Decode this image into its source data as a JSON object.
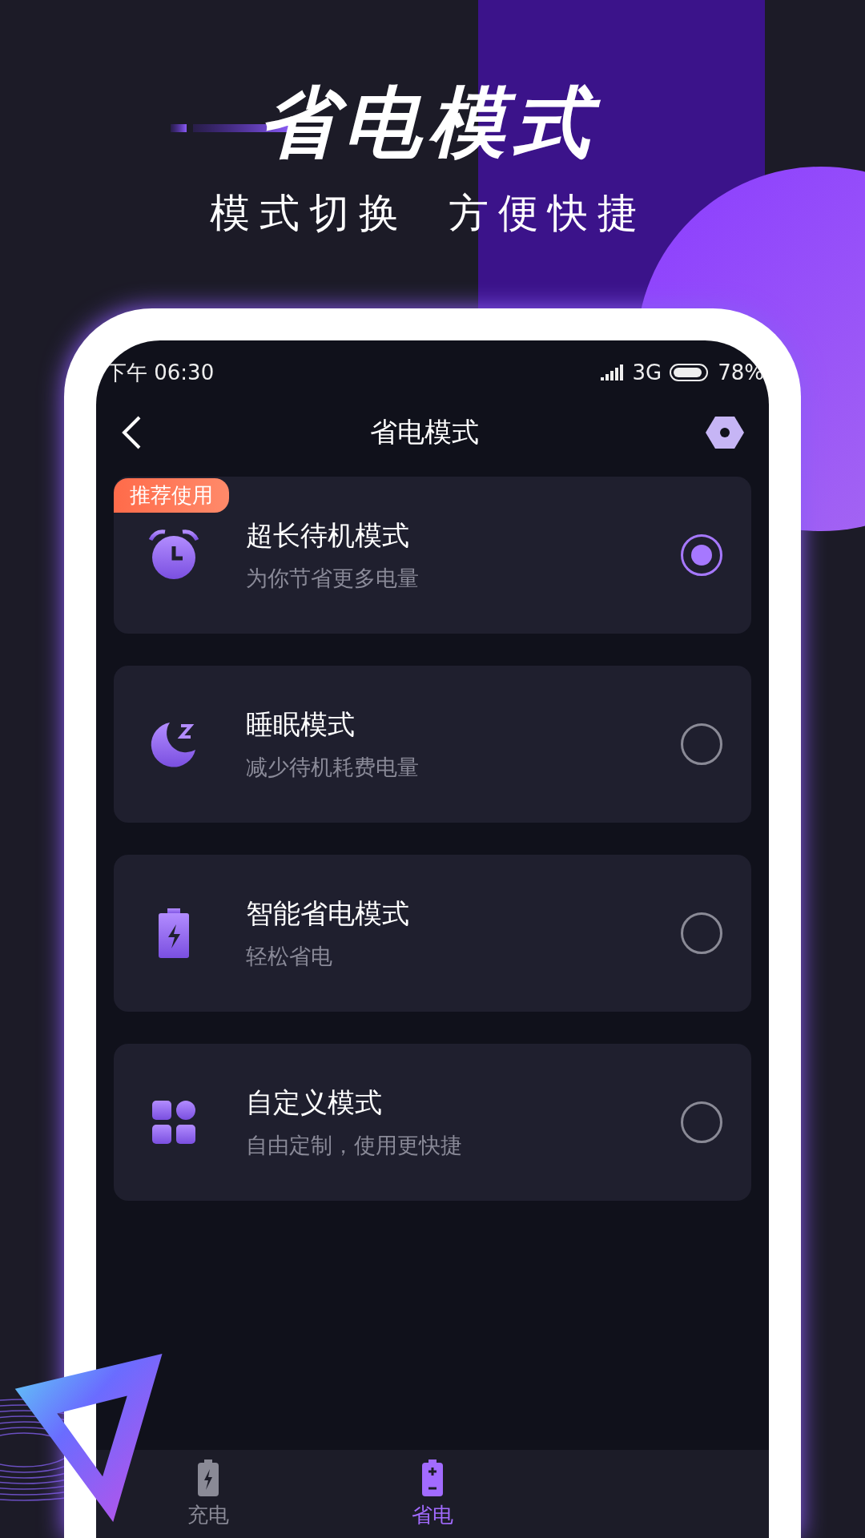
{
  "promo": {
    "title": "省电模式",
    "subtitle": [
      "模式切换",
      "方便快捷"
    ]
  },
  "status_bar": {
    "time": "下午 06:30",
    "network": "3G",
    "battery": "78%"
  },
  "nav": {
    "title": "省电模式"
  },
  "modes": [
    {
      "kind": "alarm",
      "title": "超长待机模式",
      "subtitle": "为你节省更多电量",
      "badge": "推荐使用",
      "selected": true
    },
    {
      "kind": "moon",
      "title": "睡眠模式",
      "subtitle": "减少待机耗费电量",
      "selected": false
    },
    {
      "kind": "battery",
      "title": "智能省电模式",
      "subtitle": "轻松省电",
      "selected": false
    },
    {
      "kind": "grid",
      "title": "自定义模式",
      "subtitle": "自由定制，使用更快捷",
      "selected": false
    }
  ],
  "tabs": [
    {
      "label": "充电",
      "kind": "charge",
      "selected": false
    },
    {
      "label": "省电",
      "kind": "save",
      "selected": true
    }
  ]
}
